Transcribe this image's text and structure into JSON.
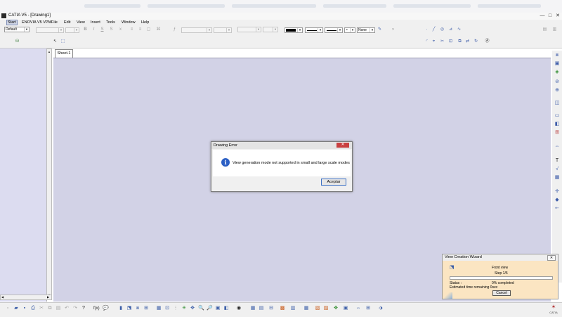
{
  "window": {
    "title": "CATIA V5 - [Drawing1]",
    "minimize": "—",
    "maximize": "□",
    "close": "✕"
  },
  "menu": [
    "Start",
    "ENOVIA V5 VPM",
    "File",
    "Edit",
    "View",
    "Insert",
    "Tools",
    "Window",
    "Help"
  ],
  "toolbar": {
    "style_combo": "Default",
    "fill_combo": "None"
  },
  "sheet_tab": "Sheet.1",
  "error_dialog": {
    "title": "Drawing Error",
    "close": "✕",
    "message": "View generation mode not supported in small and large scale modes",
    "ok_button": "Aceptar"
  },
  "wizard": {
    "title": "View Creation Wizard",
    "close": "✕",
    "view_name": "Front view",
    "step": "Step 1/5",
    "status_label": "Status :",
    "status_value": "0% completed",
    "progress": 0,
    "time_remaining": "Estimated time remaining 0sec",
    "cancel_button": "Cancel"
  },
  "logo_text": "CATIA",
  "colors": {
    "canvas": "#d2d2e6",
    "left_panel": "#dcdcf0",
    "wizard_bg": "#fbe5c2",
    "close_red": "#c94040",
    "info_blue": "#2b5fc4"
  }
}
